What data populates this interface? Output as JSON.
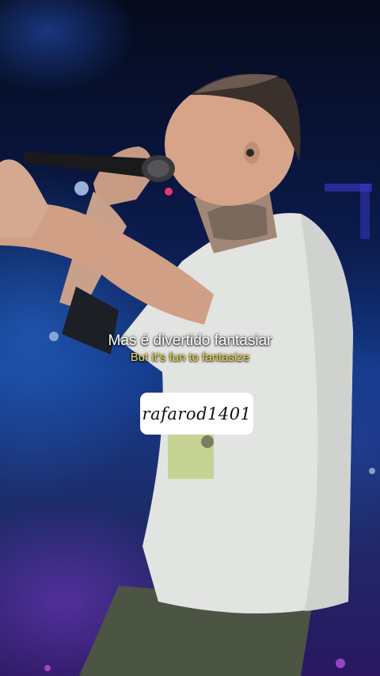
{
  "video": {
    "lyrics": {
      "original": "Mas é divertido fantasiar",
      "translation": "But it's fun to fantasize"
    },
    "watermark": "rafarod1401"
  },
  "colors": {
    "lyric_original": "#ffffff",
    "lyric_translation": "#f2d33a",
    "stage_background": "#143a8a",
    "shirt": "#e4e6e4"
  }
}
